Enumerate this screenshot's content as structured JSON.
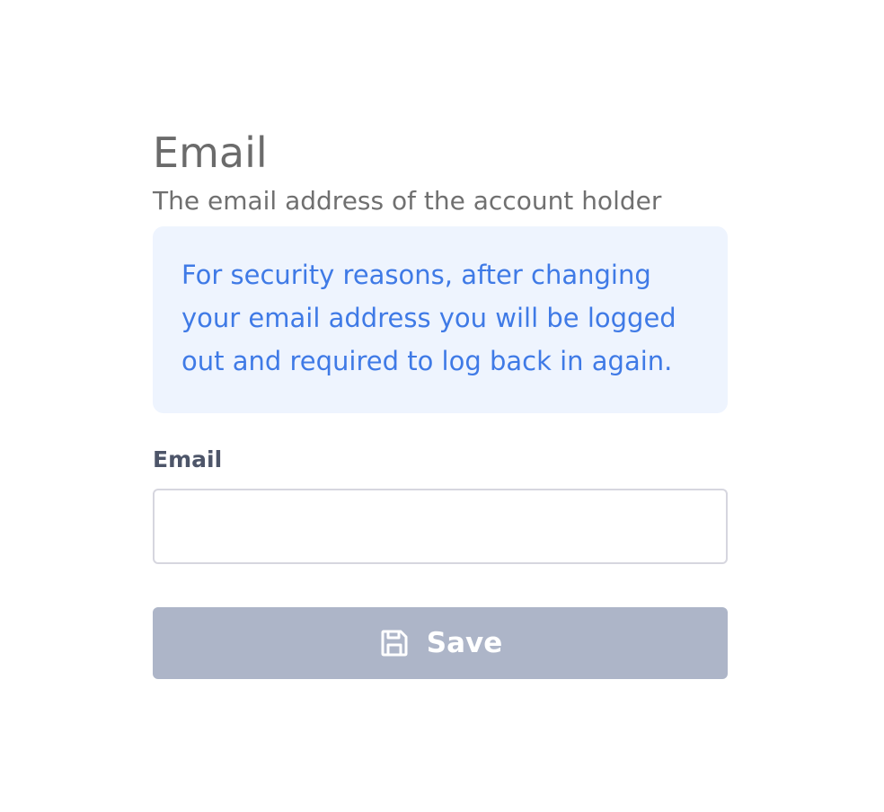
{
  "section": {
    "title": "Email",
    "subtitle": "The email address of the account holder"
  },
  "notice": {
    "text": "For security reasons, after changing your email address you will be logged out and required to log back in again."
  },
  "email_field": {
    "label": "Email",
    "value": "",
    "placeholder": ""
  },
  "save_button": {
    "label": "Save",
    "icon": "save-floppy-icon"
  },
  "colors": {
    "notice_background": "#eef4fe",
    "notice_text": "#3f7ae6",
    "button_background": "#adb5c8"
  }
}
